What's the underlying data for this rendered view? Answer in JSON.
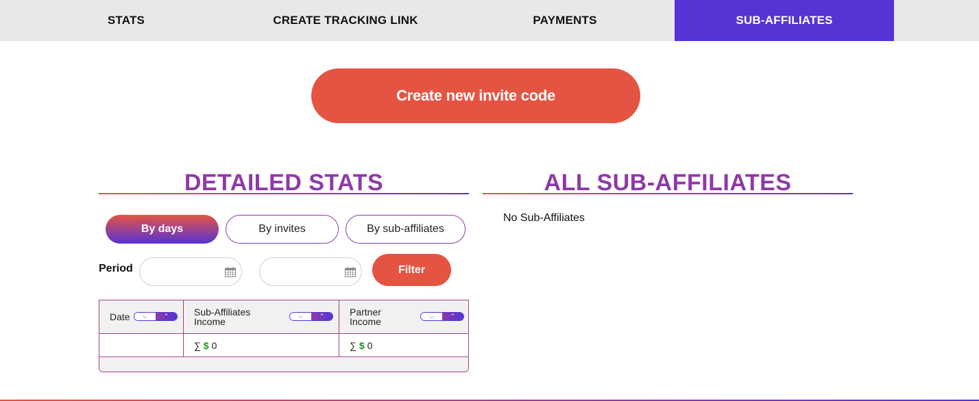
{
  "nav": {
    "tabs": [
      {
        "label": "STATS"
      },
      {
        "label": "CREATE TRACKING LINK"
      },
      {
        "label": "PAYMENTS"
      },
      {
        "label": "SUB-AFFILIATES",
        "active": true
      }
    ]
  },
  "invite_button": "Create new invite code",
  "detailed_stats": {
    "title": "DETAILED STATS",
    "modes": [
      "By days",
      "By invites",
      "By sub-affiliates"
    ],
    "active_mode": "By days",
    "period_label": "Period",
    "date_from_value": "",
    "date_to_value": "",
    "filter_label": "Filter",
    "table": {
      "columns": [
        "Date",
        "Sub-Affiliates Income",
        "Partner Income"
      ],
      "col_line1": [
        "Date",
        "Sub-Affiliates",
        "Partner"
      ],
      "col_line2": [
        "",
        "Income",
        "Income"
      ],
      "row": {
        "date": "",
        "sub_sum_symbol": "∑",
        "sub_currency": "$",
        "sub_value": "0",
        "partner_sum_symbol": "∑",
        "partner_currency": "$",
        "partner_value": "0"
      }
    }
  },
  "all_sub_affiliates": {
    "title": "ALL SUB-AFFILIATES",
    "empty_message": "No Sub-Affiliates"
  },
  "colors": {
    "accent_purple": "#5533d4",
    "accent_red": "#e55443",
    "title_purple": "#8e3aa6",
    "currency_green": "#1a9a1a"
  }
}
